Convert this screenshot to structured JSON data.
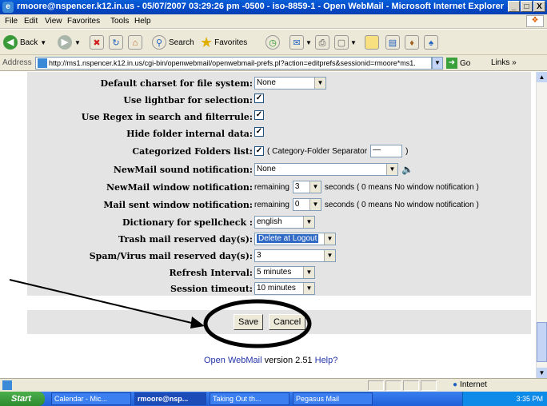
{
  "window": {
    "title": "rmoore@nspencer.k12.in.us - 05/07/2007 03:29:26 pm -0500 - iso-8859-1 - Open WebMail - Microsoft Internet Explorer",
    "controls": [
      "_",
      "□",
      "X"
    ]
  },
  "menu": [
    "File",
    "Edit",
    "View",
    "Favorites",
    "Tools",
    "Help"
  ],
  "toolbar": {
    "back": "Back",
    "search": "Search",
    "favorites": "Favorites"
  },
  "address": {
    "label": "Address",
    "url": "http://ms1.nspencer.k12.in.us/cgi-bin/openwebmail/openwebmail-prefs.pl?action=editprefs&sessionid=rmoore*ms1.",
    "go": "Go",
    "links": "Links"
  },
  "prefs": [
    {
      "label": "Default charset for file system:",
      "type": "select",
      "value": "None"
    },
    {
      "label": "Use lightbar for selection:",
      "type": "checkbox",
      "checked": true
    },
    {
      "label": "Use Regex in search and filterrule:",
      "type": "checkbox",
      "checked": true
    },
    {
      "label": "Hide folder internal data:",
      "type": "checkbox",
      "checked": true
    },
    {
      "label": "Categorized Folders list:",
      "type": "checkbox",
      "checked": true,
      "extra": "( Category-Folder Separator",
      "separator": "—",
      "close": ")"
    },
    {
      "label": "NewMail sound notification:",
      "type": "select",
      "value": "None"
    },
    {
      "label": "NewMail window notification:",
      "prefix": "remaining",
      "value": "3",
      "suffix": "seconds  ( 0 means No window notification )"
    },
    {
      "label": "Mail sent window notification:",
      "prefix": "remaining",
      "value": "0",
      "suffix": "seconds  ( 0 means No window notification )"
    },
    {
      "label": "Dictionary for spellcheck :",
      "type": "select",
      "value": "english"
    },
    {
      "label": "Trash mail reserved day(s):",
      "type": "select",
      "value": "Delete at Logout"
    },
    {
      "label": "Spam/Virus mail reserved day(s):",
      "type": "select",
      "value": "3"
    },
    {
      "label": "Refresh Interval:",
      "type": "select",
      "value": "5 minutes"
    },
    {
      "label": "Session timeout:",
      "type": "select",
      "value": "10 minutes"
    }
  ],
  "buttons": {
    "save": "Save",
    "cancel": "Cancel"
  },
  "footer": {
    "link": "Open WebMail",
    "version": "version 2.51",
    "help": "Help?"
  },
  "status": {
    "zone": "Internet"
  },
  "taskbar": {
    "start": "Start",
    "tasks": [
      "Calendar - Mic...",
      "rmoore@nsp...",
      "Taking Out th...",
      "Pegasus Mail"
    ],
    "clock": "3:35 PM"
  },
  "colors": {
    "titlebar": "#0048c8",
    "panel": "#e4e4e4",
    "link": "#2234a8",
    "annotation": "#000000"
  }
}
